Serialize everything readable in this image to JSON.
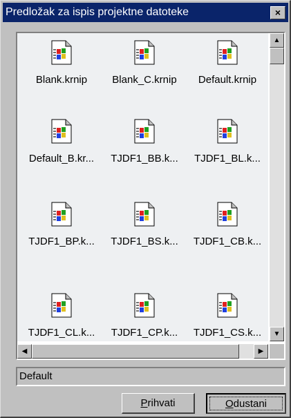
{
  "window": {
    "title": "Predložak za ispis projektne datoteke",
    "close_label": "×"
  },
  "files": [
    {
      "name": "Blank.krnip"
    },
    {
      "name": "Blank_C.krnip"
    },
    {
      "name": "Default.krnip"
    },
    {
      "name": "Default_B.kr..."
    },
    {
      "name": "TJDF1_BB.k..."
    },
    {
      "name": "TJDF1_BL.k..."
    },
    {
      "name": "TJDF1_BP.k..."
    },
    {
      "name": "TJDF1_BS.k..."
    },
    {
      "name": "TJDF1_CB.k..."
    },
    {
      "name": "TJDF1_CL.k..."
    },
    {
      "name": "TJDF1_CP.k..."
    },
    {
      "name": "TJDF1_CS.k..."
    }
  ],
  "selected_field": {
    "value": "Default"
  },
  "buttons": {
    "accept": {
      "hotkey": "P",
      "rest": "rihvati"
    },
    "cancel": {
      "hotkey": "O",
      "rest": "dustani"
    }
  },
  "icons": {
    "file_icon": "windows-file-icon"
  }
}
